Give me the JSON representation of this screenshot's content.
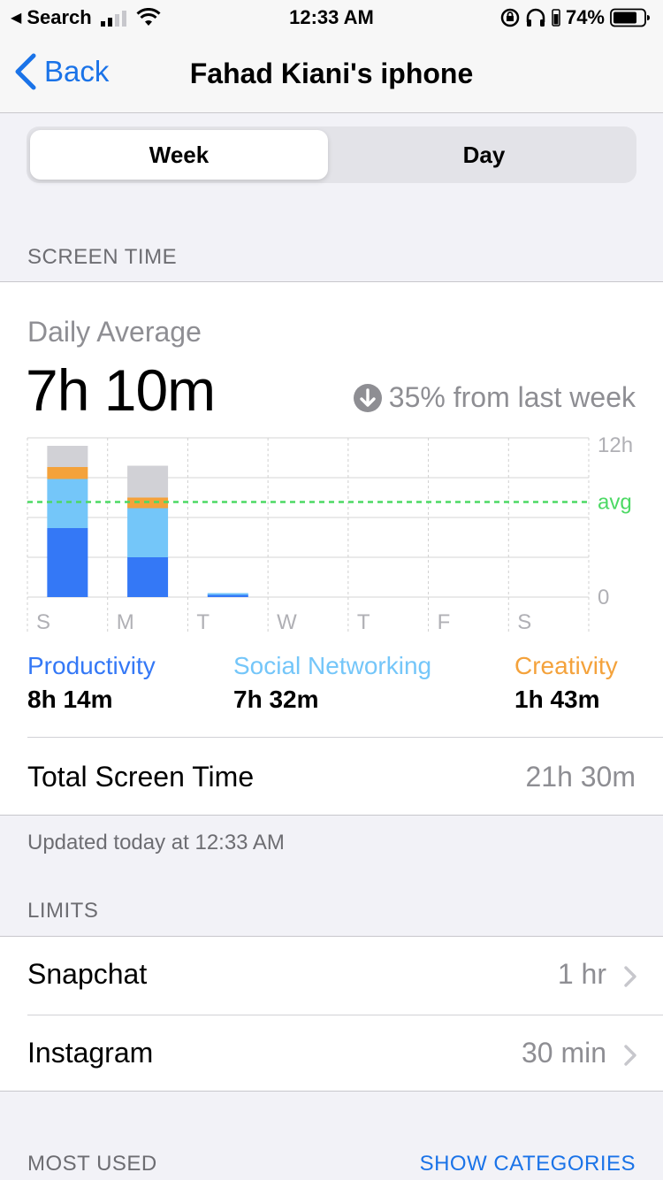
{
  "status_bar": {
    "back_app": "Search",
    "time": "12:33 AM",
    "battery": "74%"
  },
  "nav": {
    "back_label": "Back",
    "title": "Fahad Kiani's iphone"
  },
  "segments": {
    "week": "Week",
    "day": "Day",
    "selected": "Week"
  },
  "screen_time": {
    "header": "SCREEN TIME",
    "daily_label": "Daily Average",
    "daily_value": "7h 10m",
    "delta": "35% from last week",
    "categories": [
      {
        "name": "Productivity",
        "value": "8h 14m",
        "color": "#3478f6"
      },
      {
        "name": "Social Networking",
        "value": "7h 32m",
        "color": "#74c6f9"
      },
      {
        "name": "Creativity",
        "value": "1h 43m",
        "color": "#f4a23b"
      }
    ],
    "total_label": "Total Screen Time",
    "total_value": "21h 30m",
    "updated": "Updated today at 12:33 AM"
  },
  "chart_data": {
    "type": "bar",
    "stacked": true,
    "categories": [
      "S",
      "M",
      "T",
      "W",
      "T",
      "F",
      "S"
    ],
    "ylim": [
      0,
      12
    ],
    "y_ticks": [
      "12h",
      "avg",
      "0"
    ],
    "average_hours": 7.17,
    "series": [
      {
        "name": "Productivity",
        "color": "#3478f6",
        "values": [
          5.2,
          3.0,
          0.2,
          0,
          0,
          0,
          0
        ]
      },
      {
        "name": "Social Networking",
        "color": "#74c6f9",
        "values": [
          3.7,
          3.7,
          0.1,
          0,
          0,
          0,
          0
        ]
      },
      {
        "name": "Creativity",
        "color": "#f4a23b",
        "values": [
          0.9,
          0.8,
          0,
          0,
          0,
          0,
          0
        ]
      },
      {
        "color": "#d1d1d6",
        "values": [
          1.6,
          2.4,
          0,
          0,
          0,
          0,
          0
        ]
      }
    ],
    "avg_color": "#4cd964"
  },
  "limits": {
    "header": "LIMITS",
    "items": [
      {
        "name": "Snapchat",
        "value": "1 hr"
      },
      {
        "name": "Instagram",
        "value": "30 min"
      }
    ]
  },
  "most_used": {
    "header": "MOST USED",
    "action": "SHOW CATEGORIES"
  }
}
